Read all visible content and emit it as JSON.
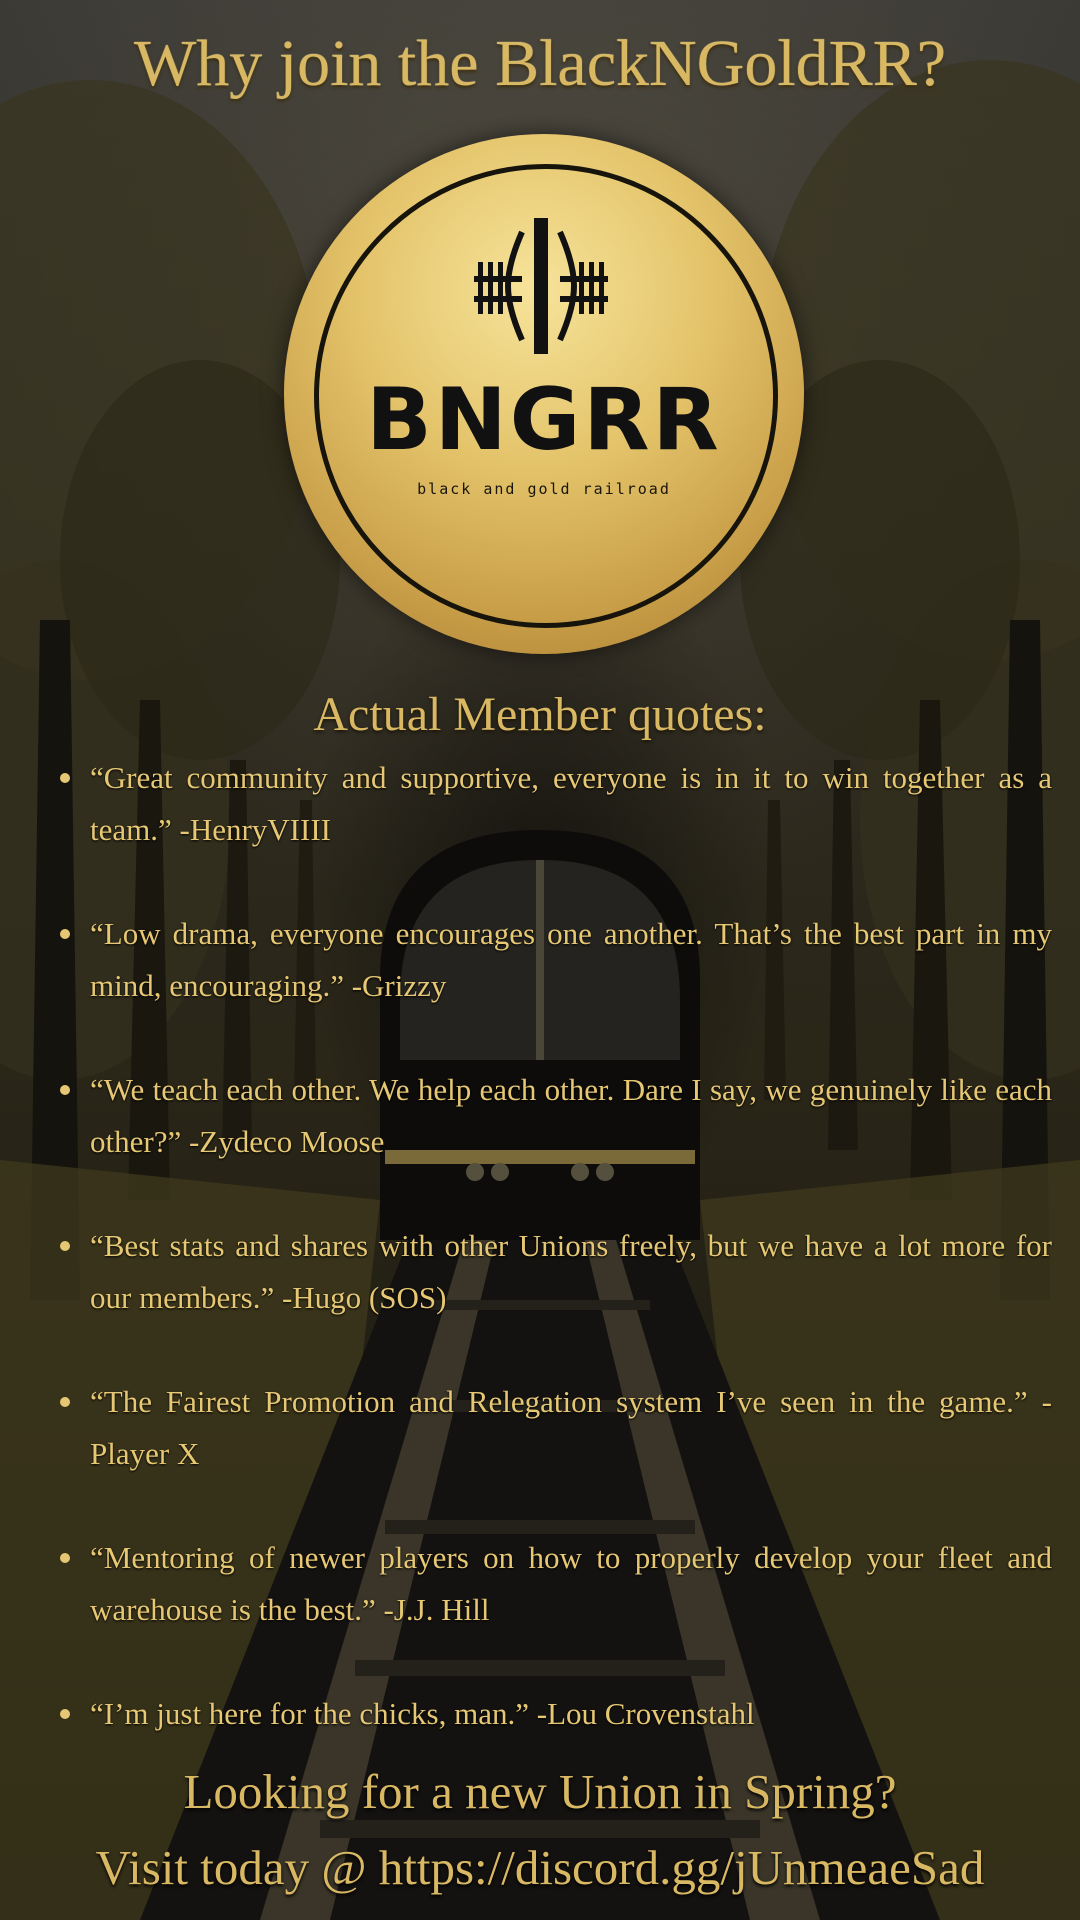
{
  "poster": {
    "title": "Why join the BlackNGoldRR?",
    "logo": {
      "brand": "BNGRR",
      "tagline": "black and gold railroad",
      "icon": "railroad-track-icon"
    },
    "quotes_heading": "Actual Member quotes:",
    "quotes": [
      "“Great community and supportive, everyone is in it to win together as a team.” -HenryVIIII",
      "“Low drama, everyone encourages one another. That’s the best part in my mind, encouraging.” -Grizzy",
      "“We teach each other. We help each other. Dare I say, we genuinely like each other?” -Zydeco Moose",
      "“Best stats and shares with other Unions freely, but we have a lot more for our members.” -Hugo (SOS)",
      "“The Fairest Promotion and Relegation system I’ve seen in the game.” -Player X",
      "“Mentoring of newer players on how to properly develop your fleet and warehouse is the best.” -J.J. Hill",
      "“I’m just here for the chicks, man.” -Lou Crovenstahl"
    ],
    "cta_line1": "Looking for a new Union in Spring?",
    "cta_line2": "Visit today @ https://discord.gg/jUnmeaeSad"
  },
  "colors": {
    "gold_text": "#e3c36e",
    "logo_gold": "#e4c46b",
    "logo_ink": "#111111",
    "background": "#1c1a14"
  }
}
